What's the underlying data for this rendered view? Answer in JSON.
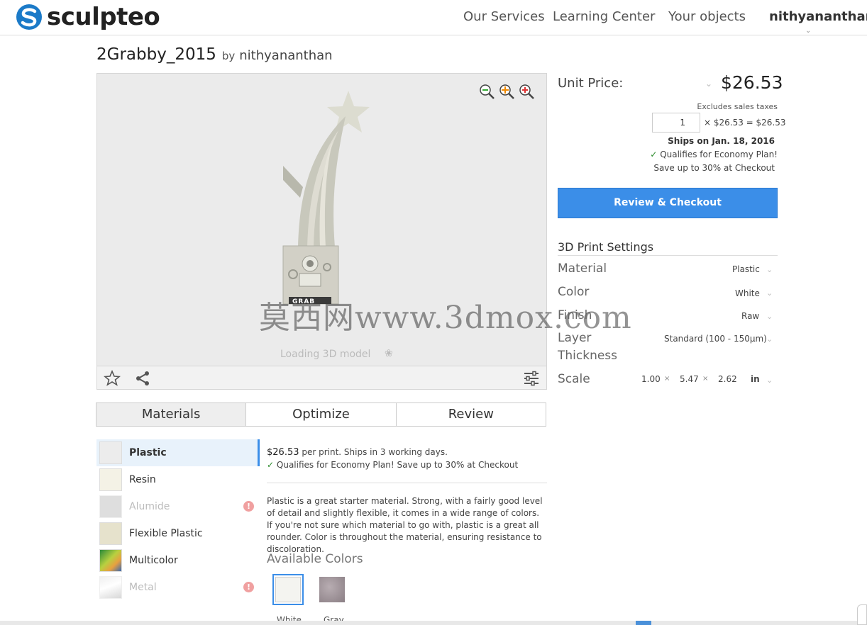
{
  "header": {
    "brand": "sculpteo",
    "nav": [
      "Our Services",
      "Learning Center",
      "Your objects"
    ],
    "user": "nithyananthan",
    "brand_color": "#1b7ac8"
  },
  "product": {
    "title": "2Grabby_2015",
    "by": "by",
    "author": "nithyananthan"
  },
  "viewer": {
    "loading_text": "Loading 3D model",
    "watermark": "莫西网www.3dmox.com",
    "model_label": "GRAB"
  },
  "pricing": {
    "unit_label": "Unit Price:",
    "unit_price": "$26.53",
    "excludes": "Excludes sales taxes",
    "quantity": "1",
    "calc": "× $26.53 = $26.53",
    "ships": "Ships on Jan. 18, 2016",
    "qualifies": "Qualifies for Economy Plan!",
    "save": "Save up to 30% at Checkout",
    "checkout_label": "Review & Checkout",
    "accent": "#3b8ee8"
  },
  "settings": {
    "title": "3D Print Settings",
    "material": {
      "label": "Material",
      "value": "Plastic"
    },
    "color": {
      "label": "Color",
      "value": "White"
    },
    "finish": {
      "label": "Finish",
      "value": "Raw"
    },
    "layer": {
      "label_1": "Layer",
      "label_2": "Thickness",
      "value": "Standard (100 - 150µm)"
    },
    "scale": {
      "label": "Scale",
      "x": "1.00",
      "y": "5.47",
      "z": "2.62",
      "unit": "in",
      "sep": "×"
    }
  },
  "tabs": [
    "Materials",
    "Optimize",
    "Review"
  ],
  "materials": [
    {
      "label": "Plastic",
      "state": "active"
    },
    {
      "label": "Resin",
      "state": "normal"
    },
    {
      "label": "Alumide",
      "state": "disabled"
    },
    {
      "label": "Flexible Plastic",
      "state": "normal"
    },
    {
      "label": "Multicolor",
      "state": "normal"
    },
    {
      "label": "Metal",
      "state": "disabled"
    }
  ],
  "detail": {
    "price": "$26.53",
    "price_suffix": "per print. Ships in 3 working days.",
    "qualifies": "Qualifies for Economy Plan! Save up to 30% at Checkout",
    "description": "Plastic is a great starter material. Strong, with a fairly good level of detail and slightly flexible, it comes in a wide range of colors. If you're not sure which material to go with, plastic is a great all rounder. Color is throughout the material, ensuring resistance to discoloration.",
    "available_title": "Available Colors",
    "colors": [
      {
        "name": "White",
        "hex": "#f4f4f0"
      },
      {
        "name": "Gray",
        "hex": "#9e9296"
      }
    ]
  }
}
